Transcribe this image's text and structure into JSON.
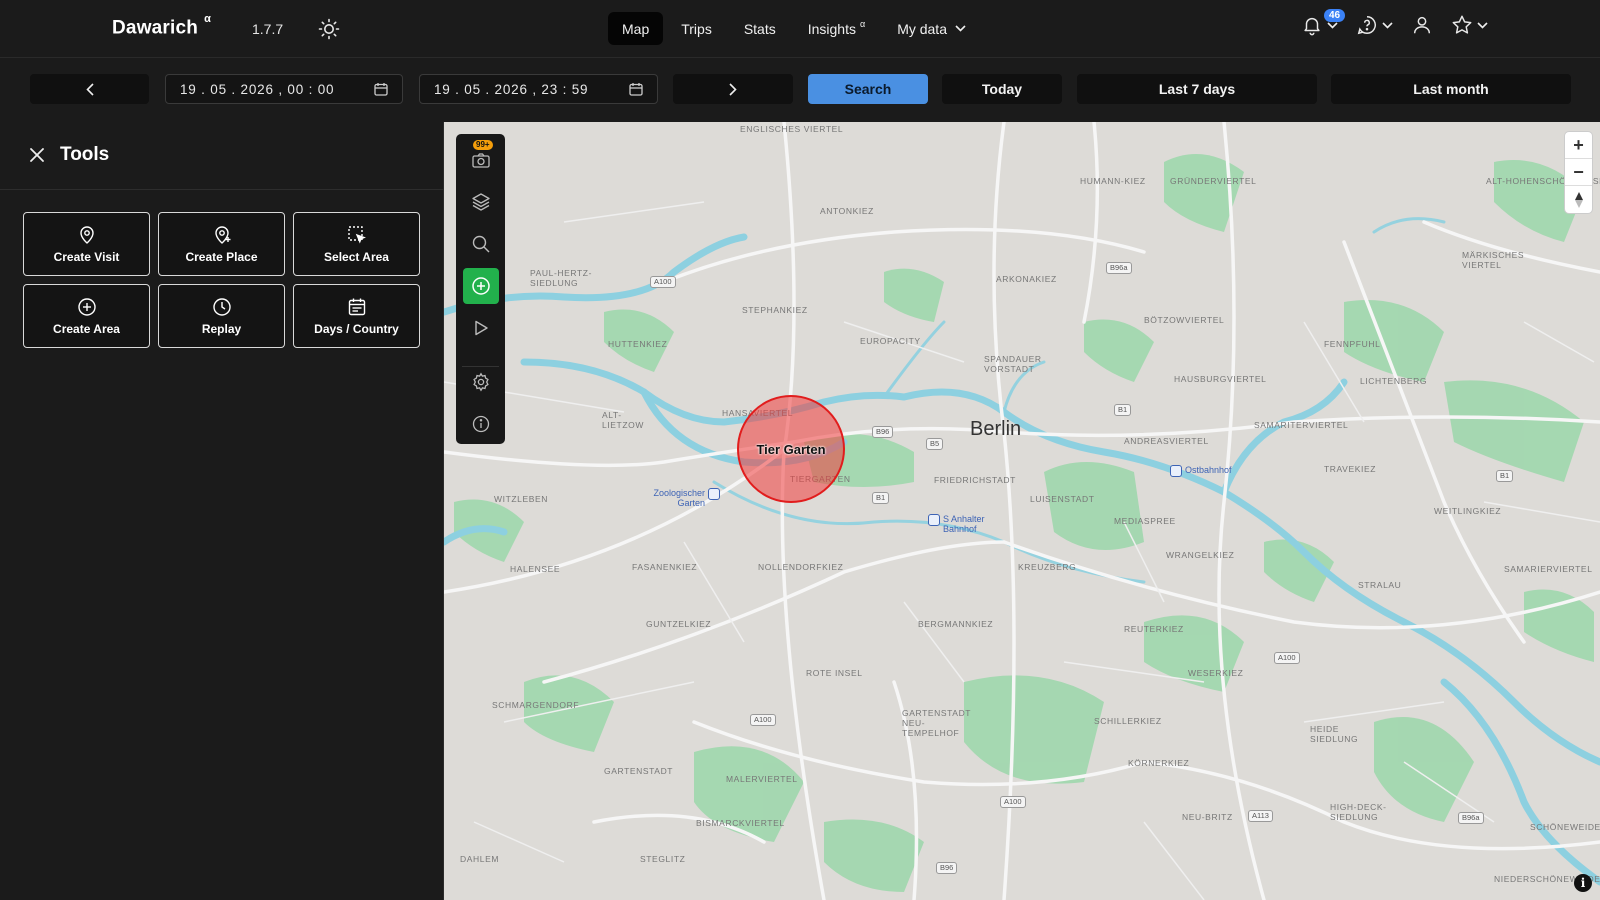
{
  "header": {
    "brand": "Dawarich",
    "brand_sup": "α",
    "version": "1.7.7",
    "nav": [
      {
        "label": "Map",
        "active": true
      },
      {
        "label": "Trips"
      },
      {
        "label": "Stats"
      },
      {
        "label": "Insights",
        "sup": "α"
      },
      {
        "label": "My data",
        "dropdown": true
      }
    ],
    "notifications_count": "46"
  },
  "datebar": {
    "start": "19 . 05 . 2026 ,  00 : 00",
    "end": "19 . 05 . 2026 ,  23 : 59",
    "search": "Search",
    "today": "Today",
    "last7": "Last 7 days",
    "lastmonth": "Last month"
  },
  "tools": {
    "title": "Tools",
    "items": [
      {
        "label": "Create Visit",
        "icon": "map-pin-icon"
      },
      {
        "label": "Create Place",
        "icon": "map-pin-plus-icon"
      },
      {
        "label": "Select Area",
        "icon": "select-area-icon"
      },
      {
        "label": "Create Area",
        "icon": "plus-circle-icon"
      },
      {
        "label": "Replay",
        "icon": "clock-icon"
      },
      {
        "label": "Days / Country",
        "icon": "calendar-icon"
      }
    ]
  },
  "map": {
    "toolbar_badge": "99+",
    "city": "Berlin",
    "visit_label": "Tier Garten",
    "districts": [
      "ENGLISCHES VIERTEL",
      "HUMANN-KIEZ",
      "GRÜNDERVIERTEL",
      "ALT-HOHENSCHÖNHAUSEN",
      "ANTONKIEZ",
      "PAUL-HERTZ-SIEDLUNG",
      "ARKONAKIEZ",
      "BÖTZOWVIERTEL",
      "MÄRKISCHES VIERTEL",
      "STEPHANKIEZ",
      "HUTTENKIEZ",
      "EUROPACITY",
      "SPANDAUER VORSTADT",
      "FENNPFUHL",
      "HAUSBURGVIERTEL",
      "LICHTENBERG",
      "HANSAVIERTEL",
      "ALT-LIETZOW",
      "SAMARITERVIERTEL",
      "ANDREASVIERTEL",
      "FRIEDRICHSTADT",
      "TRAVEKIEZ",
      "WITZLEBEN",
      "LUISENSTADT",
      "TIERGARTEN",
      "MEDIASPREE",
      "WEITLINGKIEZ",
      "HALENSEE",
      "FASANENKIEZ",
      "NOLLENDORFKIEZ",
      "KREUZBERG",
      "WRANGELKIEZ",
      "STRALAU",
      "SAMARIERVIERTEL",
      "GUNTZELKIEZ",
      "BERGMANNKIEZ",
      "REUTERKIEZ",
      "WESERKIEZ",
      "SCHMARGENDORF",
      "ROTE INSEL",
      "GARTENSTADT NEU-TEMPELHOF",
      "SCHILLERKIEZ",
      "KÖRNERKIEZ",
      "HEIDE SIEDLUNG",
      "GARTENSTADT",
      "MALERVIERTEL",
      "BISMARCKVIERTEL",
      "NEU-BRITZ",
      "HIGH-DECK-SIEDLUNG",
      "DAHLEM",
      "STEGLITZ",
      "NIEDERSCHÖNEWEIDE",
      "SCHÖNEWEIDE"
    ],
    "roads": [
      "A100",
      "B96a",
      "B96",
      "B5",
      "B1",
      "B1",
      "B1",
      "A100",
      "A100",
      "A100",
      "A113",
      "B96a",
      "B96"
    ],
    "stations": [
      {
        "name": "Ostbahnhof"
      },
      {
        "name": "Zoologischer Garten"
      },
      {
        "name": "S Anhalter Bahnhof"
      }
    ]
  }
}
